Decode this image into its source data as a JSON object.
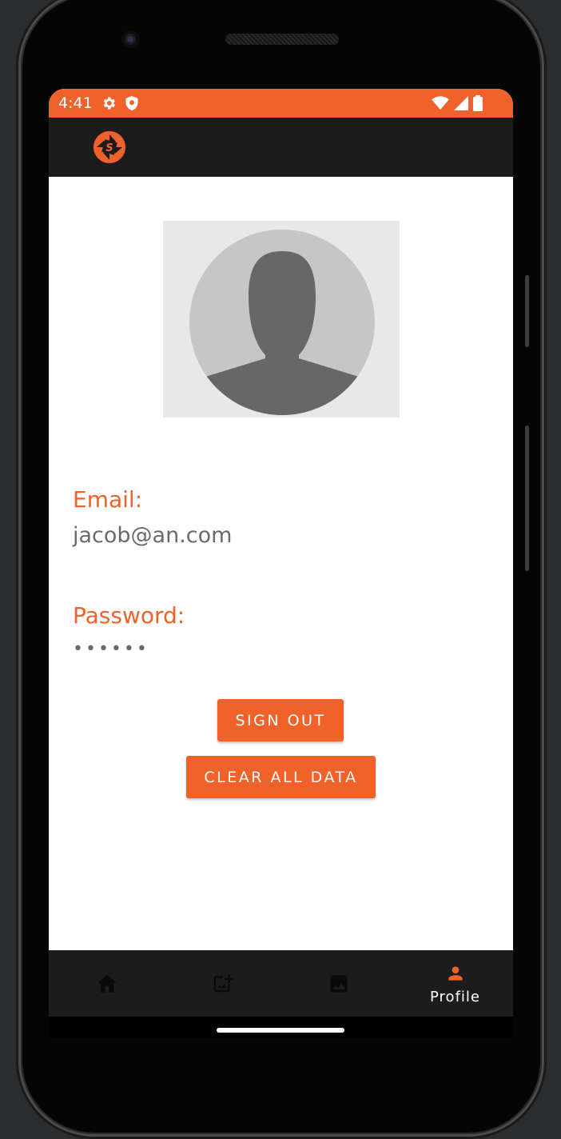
{
  "status_bar": {
    "time": "4:41",
    "left_icons": [
      "gear-icon",
      "shield-icon"
    ],
    "right_icons": [
      "wifi-icon",
      "signal-icon",
      "battery-icon"
    ]
  },
  "app_bar": {
    "logo_icon": "aperture-logo-icon",
    "logo_letter": "S"
  },
  "profile": {
    "avatar_icon": "default-avatar-icon",
    "email_label": "Email:",
    "email_value": "jacob@an.com",
    "password_label": "Password:",
    "password_value": "••••••"
  },
  "actions": {
    "sign_out_label": "SIGN OUT",
    "clear_all_label": "CLEAR ALL DATA"
  },
  "bottom_nav": {
    "items": [
      {
        "icon": "home-icon",
        "label": "",
        "active": false
      },
      {
        "icon": "add-photo-icon",
        "label": "",
        "active": false
      },
      {
        "icon": "image-icon",
        "label": "",
        "active": false
      },
      {
        "icon": "person-icon",
        "label": "Profile",
        "active": true
      }
    ]
  },
  "colors": {
    "accent": "#f0622a",
    "app_bar": "#1c1c1c",
    "text_value": "#6b6b6b",
    "inactive_icon": "#0a0a0a"
  }
}
